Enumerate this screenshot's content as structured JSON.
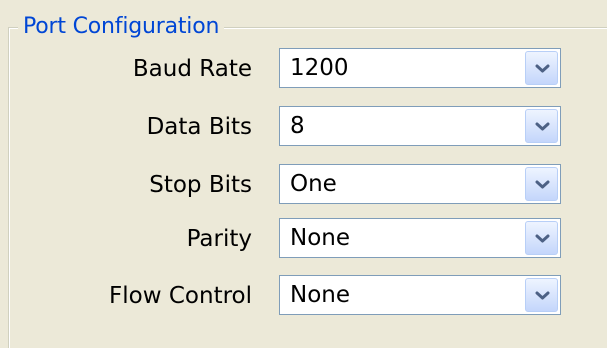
{
  "group": {
    "title": "Port Configuration"
  },
  "fields": [
    {
      "label": "Baud Rate",
      "value": "1200"
    },
    {
      "label": "Data Bits",
      "value": "8"
    },
    {
      "label": "Stop Bits",
      "value": "One"
    },
    {
      "label": "Parity",
      "value": "None"
    },
    {
      "label": "Flow Control",
      "value": "None"
    }
  ],
  "icons": {
    "dropdown": "chevron-down-icon"
  },
  "colors": {
    "title": "#0046d5",
    "background": "#ece9d8",
    "field_border": "#7f9db9"
  }
}
